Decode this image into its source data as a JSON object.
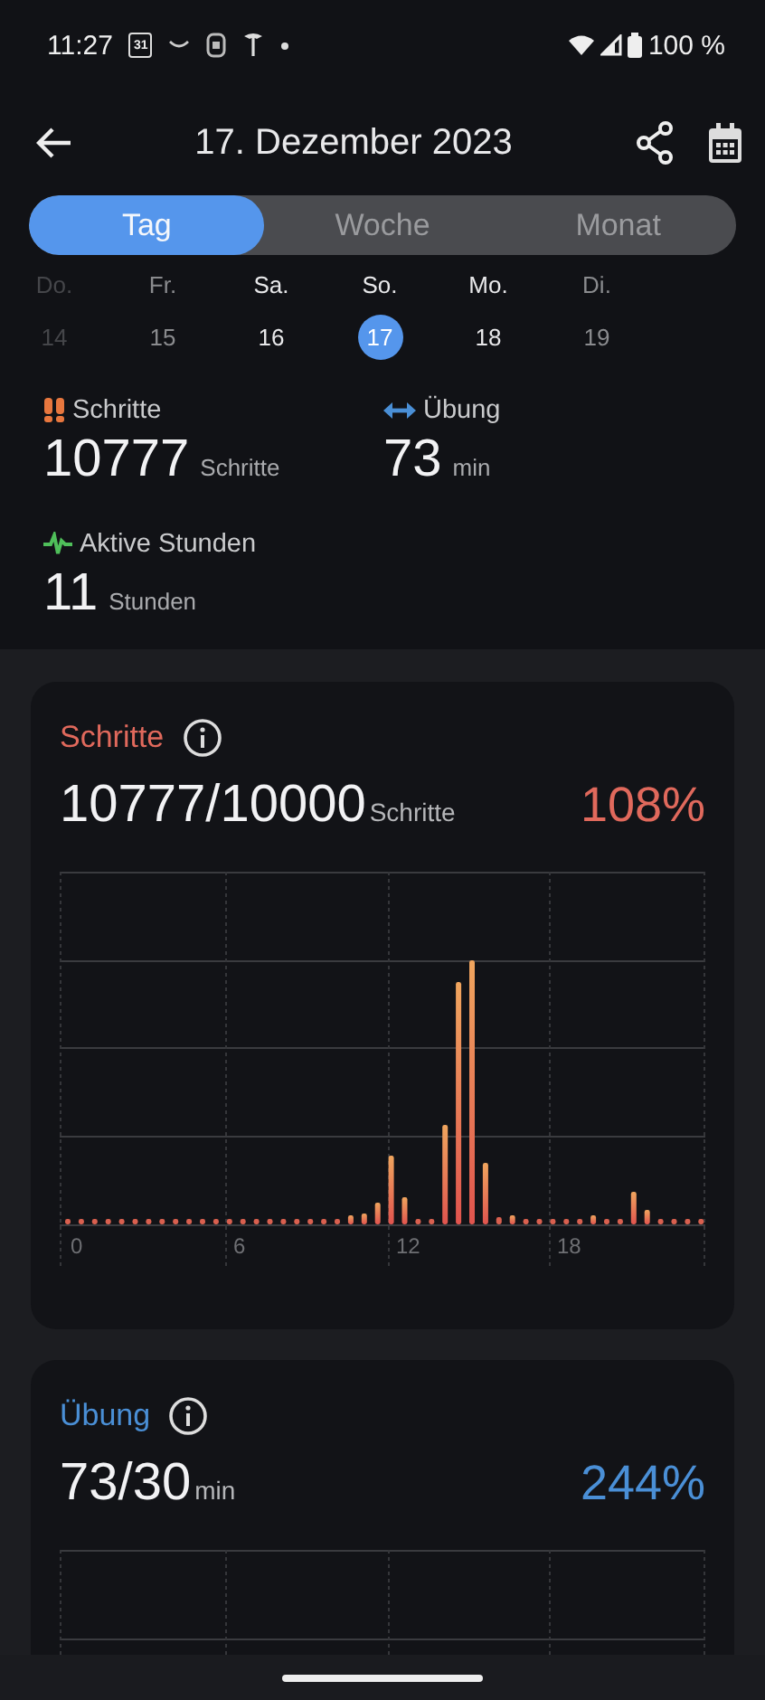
{
  "status_bar": {
    "time": "11:27",
    "calendar_day": "31",
    "battery": "100 %"
  },
  "header": {
    "title": "17. Dezember 2023"
  },
  "tabs": [
    {
      "label": "Tag",
      "selected": true
    },
    {
      "label": "Woche",
      "selected": false
    },
    {
      "label": "Monat",
      "selected": false
    }
  ],
  "week": [
    {
      "day": "Do.",
      "date": "14",
      "kind": "faded",
      "selected": false
    },
    {
      "day": "Fr.",
      "date": "15",
      "kind": "muted",
      "selected": false
    },
    {
      "day": "Sa.",
      "date": "16",
      "kind": "normal",
      "selected": false
    },
    {
      "day": "So.",
      "date": "17",
      "kind": "normal",
      "selected": true
    },
    {
      "day": "Mo.",
      "date": "18",
      "kind": "normal",
      "selected": false
    },
    {
      "day": "Di.",
      "date": "19",
      "kind": "muted",
      "selected": false
    }
  ],
  "summary": [
    {
      "kind": "steps",
      "label": "Schritte",
      "value": "10777",
      "unit": "Schritte"
    },
    {
      "kind": "exercise",
      "label": "Übung",
      "value": "73",
      "unit": "min"
    },
    {
      "kind": "active",
      "label": "Aktive Stunden",
      "value": "11",
      "unit": "Stunden"
    }
  ],
  "cards": [
    {
      "kind": "steps",
      "title": "Schritte",
      "color": "#e0695c",
      "value": "10777/10000",
      "unit": "Schritte",
      "percent": "108%",
      "x_labels": [
        "0",
        "6",
        "12",
        "18"
      ]
    },
    {
      "kind": "exercise",
      "title": "Übung",
      "color": "#4a8fd6",
      "value": "73/30",
      "unit": "min",
      "percent": "244%"
    }
  ]
}
